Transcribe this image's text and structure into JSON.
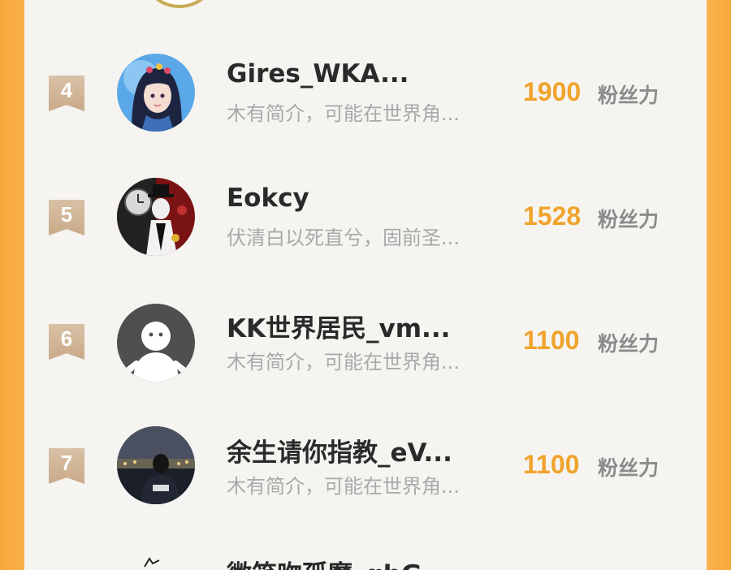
{
  "ranking": {
    "unit_label": "粉丝力",
    "entries": [
      {
        "rank": "4",
        "name": "Gires_WKA...",
        "bio": "木有简介，可能在世界角...",
        "score": "1900",
        "avatar": "anime-girl-avatar"
      },
      {
        "rank": "5",
        "name": "Eokcy",
        "bio": "伏清白以死直兮，固前圣...",
        "score": "1528",
        "avatar": "anime-character-avatar"
      },
      {
        "rank": "6",
        "name": "KK世界居民_vm...",
        "bio": "木有简介，可能在世界角...",
        "score": "1100",
        "avatar": "default-user-avatar"
      },
      {
        "rank": "7",
        "name": "余生请你指教_eV...",
        "bio": "木有简介，可能在世界角...",
        "score": "1100",
        "avatar": "night-city-avatar"
      }
    ],
    "partial_next_name": "微笑吻孤魔_gbG..."
  },
  "colors": {
    "accent_score": "#f0a32c",
    "rank_badge": "#d4b89a",
    "side_border": "#f7a83a",
    "name_text": "#2a2a2a",
    "bio_text": "#a9a9a9"
  }
}
